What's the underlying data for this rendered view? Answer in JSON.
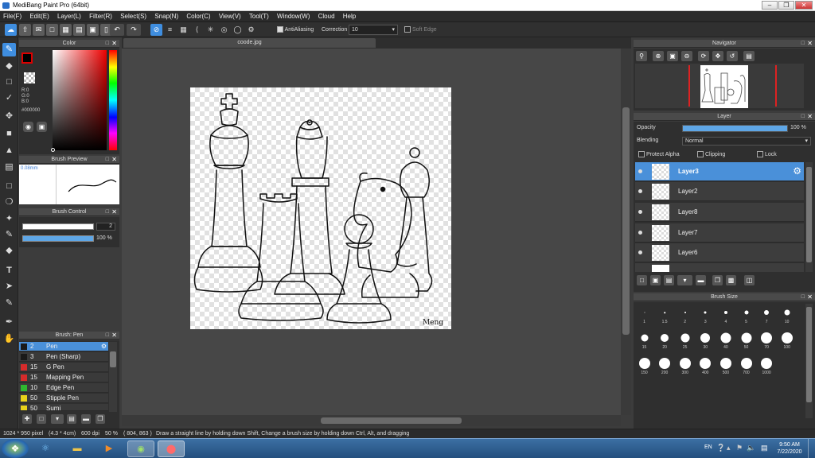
{
  "window": {
    "title": "MediBang Paint Pro (64bit)"
  },
  "menu": [
    "File(F)",
    "Edit(E)",
    "Layer(L)",
    "Filter(R)",
    "Select(S)",
    "Snap(N)",
    "Color(C)",
    "View(V)",
    "Tool(T)",
    "Window(W)",
    "Cloud",
    "Help"
  ],
  "toolbar": {
    "antialiasing_label": "AntiAliasing",
    "correction_label": "Correction",
    "correction_value": "10",
    "soft_edge_label": "Soft Edge"
  },
  "color_panel": {
    "title": "Color",
    "r": "R:0",
    "g": "G:0",
    "b": "B:0",
    "hex": "#000000",
    "foreground": "#000000",
    "background": "#ffffff"
  },
  "brush_preview": {
    "title": "Brush Preview",
    "size": "0.08mm"
  },
  "brush_control": {
    "title": "Brush Control",
    "size_value": "2",
    "opacity_value": "100 %"
  },
  "brush_list": {
    "title": "Brush: Pen",
    "items": [
      {
        "size": "2",
        "name": "Pen",
        "color": "#1a1a1a"
      },
      {
        "size": "3",
        "name": "Pen (Sharp)",
        "color": "#1a1a1a"
      },
      {
        "size": "15",
        "name": "G Pen",
        "color": "#d62b2b"
      },
      {
        "size": "15",
        "name": "Mapping Pen",
        "color": "#d62b2b"
      },
      {
        "size": "10",
        "name": "Edge Pen",
        "color": "#2fb62f"
      },
      {
        "size": "50",
        "name": "Stipple Pen",
        "color": "#e8d21a"
      },
      {
        "size": "50",
        "name": "Sumi",
        "color": "#e8d21a"
      }
    ]
  },
  "document_tab": {
    "name": "coode.jpg"
  },
  "canvas": {
    "signature": "Meng"
  },
  "navigator": {
    "title": "Navigator"
  },
  "layer_panel": {
    "title": "Layer",
    "opacity_label": "Opacity",
    "opacity_value": "100 %",
    "blending_label": "Blending",
    "blending_value": "Normal",
    "protect_alpha": "Protect Alpha",
    "clipping": "Clipping",
    "lock": "Lock",
    "layers": [
      "Layer3",
      "Layer2",
      "Layer8",
      "Layer7",
      "Layer6"
    ]
  },
  "brush_size": {
    "title": "Brush Size",
    "sizes": [
      "1",
      "1.5",
      "2",
      "3",
      "4",
      "5",
      "7",
      "10",
      "15",
      "20",
      "25",
      "30",
      "40",
      "50",
      "70",
      "100",
      "150",
      "200",
      "300",
      "400",
      "500",
      "700",
      "1000"
    ]
  },
  "status": {
    "canvas_size": "1024 * 950 pixel",
    "physical_size": "(4.3 * 4cm)",
    "dpi": "600 dpi",
    "zoom": "50 %",
    "coords": "( 804, 863 )",
    "hint": "Draw a straight line by holding down Shift, Change a brush size by holding down Ctrl, Alt, and dragging"
  },
  "taskbar": {
    "language": "EN",
    "time": "9:50 AM",
    "date": "7/22/2020"
  }
}
